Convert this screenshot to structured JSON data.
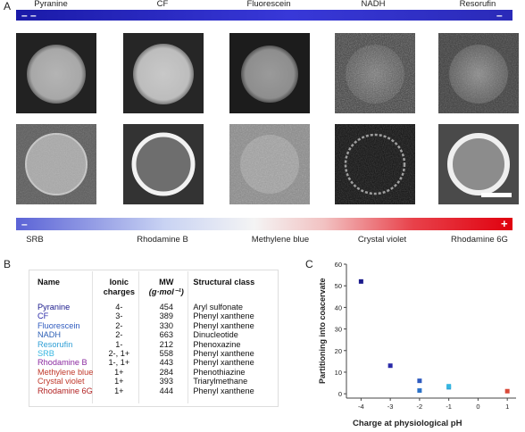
{
  "panel_a": {
    "letter": "A",
    "top_bar": {
      "left_sign": "– –",
      "right_sign": "–"
    },
    "top_dyes": [
      "Pyranine",
      "CF",
      "Fluorescein",
      "NADH",
      "Resorufin"
    ],
    "bottom_bar": {
      "left_sign": "–",
      "right_sign": "+"
    },
    "bottom_dyes": [
      "SRB",
      "Rhodamine B",
      "Methylene blue",
      "Crystal violet",
      "Rhodamine 6G"
    ]
  },
  "panel_b": {
    "letter": "B",
    "headers": {
      "name": "Name",
      "charges_1": "Ionic",
      "charges_2": "charges",
      "mw_1": "MW",
      "mw_2": "(g·mol⁻¹)",
      "class": "Structural class"
    },
    "rows": [
      {
        "name": "Pyranine",
        "color": "#1a1a8c",
        "charges": "4-",
        "mw": "454",
        "class": "Aryl sulfonate"
      },
      {
        "name": "CF",
        "color": "#2a2aa8",
        "charges": "3-",
        "mw": "389",
        "class": "Phenyl xanthene"
      },
      {
        "name": "Fluorescein",
        "color": "#2f5bbf",
        "charges": "2-",
        "mw": "330",
        "class": "Phenyl xanthene"
      },
      {
        "name": "NADH",
        "color": "#2c5fb5",
        "charges": "2-",
        "mw": "663",
        "class": "Dinucleotide"
      },
      {
        "name": "Resorufin",
        "color": "#2f9fd6",
        "charges": "1-",
        "mw": "212",
        "class": "Phenoxazine"
      },
      {
        "name": "SRB",
        "color": "#35b6e0",
        "charges": "2-, 1+",
        "mw": "558",
        "class": "Phenyl xanthene"
      },
      {
        "name": "Rhodamine B",
        "color": "#8b2aa0",
        "charges": "1-, 1+",
        "mw": "443",
        "class": "Phenyl xanthene"
      },
      {
        "name": "Methylene blue",
        "color": "#c0392b",
        "charges": "1+",
        "mw": "284",
        "class": "Phenothiazine"
      },
      {
        "name": "Crystal violet",
        "color": "#c0392b",
        "charges": "1+",
        "mw": "393",
        "class": "Triarylmethane"
      },
      {
        "name": "Rhodamine 6G",
        "color": "#b22222",
        "charges": "1+",
        "mw": "444",
        "class": "Phenyl xanthene"
      }
    ]
  },
  "panel_c": {
    "letter": "C"
  },
  "chart_data": {
    "type": "scatter",
    "title": "",
    "xlabel": "Charge at physiological pH",
    "ylabel": "Partitioning into coacervate",
    "xlim": [
      -4.5,
      1.3
    ],
    "ylim": [
      -2,
      60
    ],
    "xticks": [
      -4,
      -3,
      -2,
      -1,
      0,
      1
    ],
    "yticks": [
      0,
      10,
      20,
      30,
      40,
      50,
      60
    ],
    "grid": false,
    "legend": "none",
    "points": [
      {
        "x": -4,
        "y": 52,
        "color": "#1a1a8c"
      },
      {
        "x": -3,
        "y": 13,
        "color": "#2a2aa8"
      },
      {
        "x": -2,
        "y": 6,
        "color": "#2f5bbf"
      },
      {
        "x": -2,
        "y": 1.5,
        "color": "#2c72c8"
      },
      {
        "x": -1,
        "y": 3,
        "color": "#2f9fd6"
      },
      {
        "x": -1,
        "y": 3.5,
        "color": "#35b6e0"
      },
      {
        "x": 1,
        "y": 1.2,
        "color": "#d94a3a"
      }
    ]
  }
}
